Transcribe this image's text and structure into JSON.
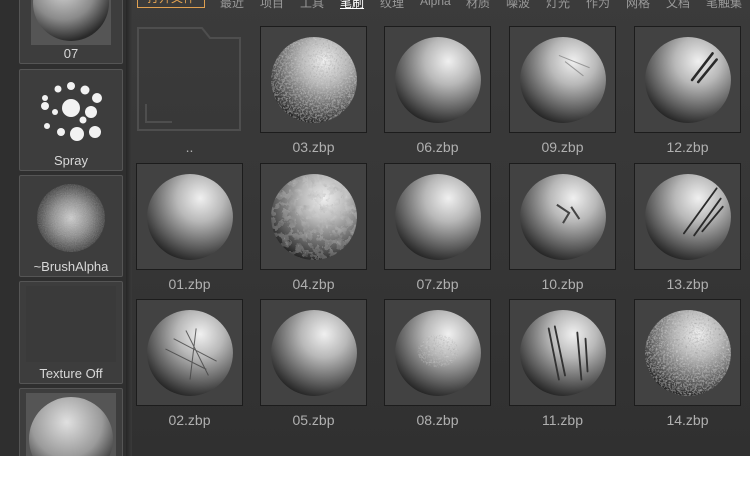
{
  "menu": {
    "open_file": "打开文件",
    "items": [
      {
        "label": "最近",
        "active": false
      },
      {
        "label": "项目",
        "active": false
      },
      {
        "label": "工具",
        "active": false
      },
      {
        "label": "笔刷",
        "active": true
      },
      {
        "label": "纹理",
        "active": false
      },
      {
        "label": "Alpha",
        "active": false
      },
      {
        "label": "材质",
        "active": false
      },
      {
        "label": "噪波",
        "active": false
      },
      {
        "label": "灯光",
        "active": false
      },
      {
        "label": "作为",
        "active": false
      },
      {
        "label": "网格",
        "active": false
      },
      {
        "label": "文档",
        "active": false
      },
      {
        "label": "笔触集",
        "active": false
      }
    ]
  },
  "sidebar": {
    "items": [
      {
        "label": "07"
      },
      {
        "label": "Spray"
      },
      {
        "label": "~BrushAlpha"
      },
      {
        "label": "Texture Off"
      },
      {
        "label": ""
      }
    ]
  },
  "browser": {
    "folder_up_label": "..",
    "files": [
      "03.zbp",
      "06.zbp",
      "09.zbp",
      "12.zbp",
      "01.zbp",
      "04.zbp",
      "07.zbp",
      "10.zbp",
      "13.zbp",
      "02.zbp",
      "05.zbp",
      "08.zbp",
      "11.zbp",
      "14.zbp"
    ]
  },
  "colors": {
    "accent": "#e0a050",
    "background": "#383838",
    "cell": "#424242"
  }
}
